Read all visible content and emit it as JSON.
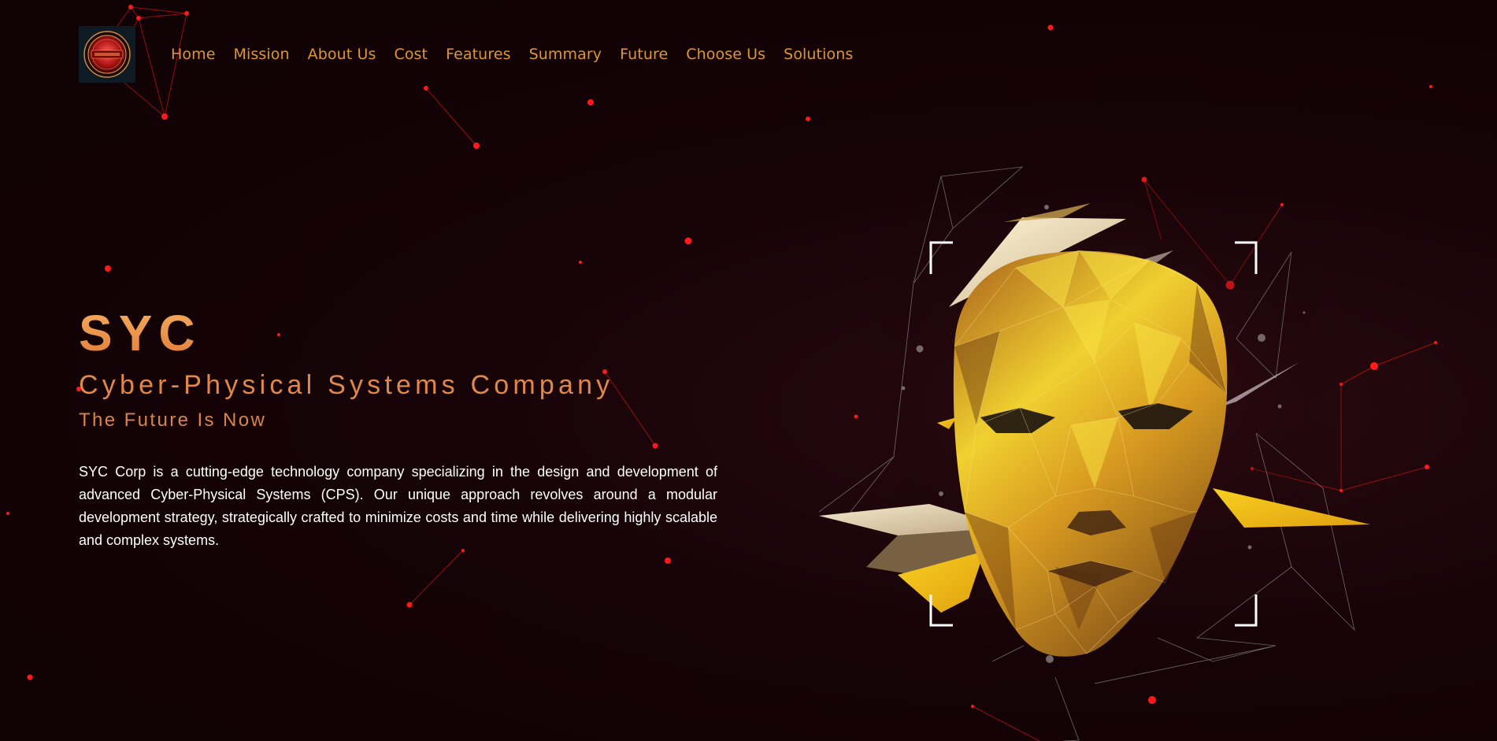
{
  "nav": {
    "logo_icon": "syc-corp-logo-icon",
    "items": [
      {
        "label": "Home"
      },
      {
        "label": "Mission"
      },
      {
        "label": "About Us"
      },
      {
        "label": "Cost"
      },
      {
        "label": "Features"
      },
      {
        "label": "Summary"
      },
      {
        "label": "Future"
      },
      {
        "label": "Choose Us"
      },
      {
        "label": "Solutions"
      }
    ]
  },
  "hero": {
    "brand": "SYC",
    "tagline": "Cyber-Physical Systems Company",
    "motto": "The Future Is Now",
    "description": "SYC Corp is a cutting-edge technology company specializing in the design and development of advanced Cyber-Physical Systems (CPS). Our unique approach revolves around a modular development strategy, strategically crafted to minimize costs and time while delivering highly scalable and complex systems."
  },
  "art": {
    "icon": "low-poly-gold-face-icon"
  },
  "colors": {
    "background": "#120205",
    "nav_text": "#e0962e",
    "accent_orange": "#e0874a",
    "node_red": "#ff1a1a",
    "gold": "#f0c020"
  }
}
